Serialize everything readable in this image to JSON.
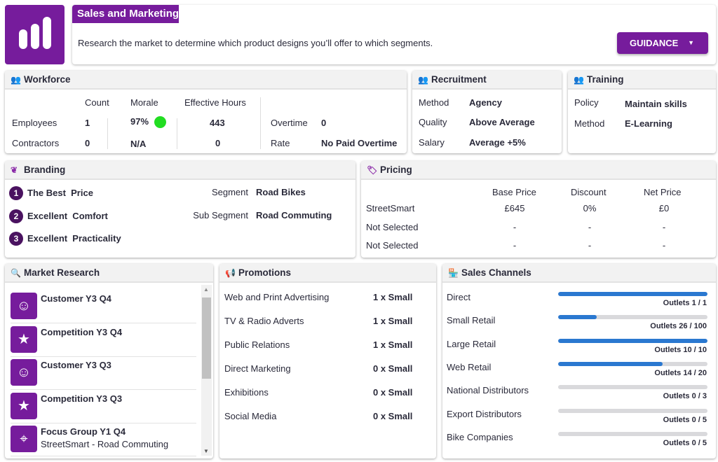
{
  "header": {
    "title": "Sales and Marketing",
    "description": "Research the market to determine which product designs you’ll offer to which segments.",
    "guidance_label": "GUIDANCE"
  },
  "workforce": {
    "title": "Workforce",
    "cols": [
      "Count",
      "Morale",
      "Effective Hours"
    ],
    "rows": [
      {
        "label": "Employees",
        "count": "1",
        "morale": "97%",
        "hours": "443"
      },
      {
        "label": "Contractors",
        "count": "0",
        "morale": "N/A",
        "hours": "0"
      }
    ],
    "overtime_label": "Overtime",
    "overtime": "0",
    "rate_label": "Rate",
    "rate": "No Paid Overtime",
    "morale_icon": "smiley-green"
  },
  "recruitment": {
    "title": "Recruitment",
    "rows": [
      {
        "k": "Method",
        "v": "Agency"
      },
      {
        "k": "Quality",
        "v": "Above Average"
      },
      {
        "k": "Salary",
        "v": "Average +5%"
      }
    ]
  },
  "training": {
    "title": "Training",
    "rows": [
      {
        "k": "Policy",
        "v": "Maintain skills"
      },
      {
        "k": "Method",
        "v": "E-Learning"
      }
    ]
  },
  "branding": {
    "title": "Branding",
    "items": [
      {
        "n": "1",
        "text": "The Best  Price"
      },
      {
        "n": "2",
        "text": "Excellent  Comfort"
      },
      {
        "n": "3",
        "text": "Excellent  Practicality"
      }
    ],
    "segment_label": "Segment",
    "segment": "Road Bikes",
    "sub_segment_label": "Sub Segment",
    "sub_segment": "Road Commuting"
  },
  "pricing": {
    "title": "Pricing",
    "cols": [
      "Base Price",
      "Discount",
      "Net Price"
    ],
    "rows": [
      {
        "name": "StreetSmart",
        "base": "£645",
        "discount": "0%",
        "net": "£0"
      },
      {
        "name": "Not Selected",
        "base": "-",
        "discount": "-",
        "net": "-"
      },
      {
        "name": "Not Selected",
        "base": "-",
        "discount": "-",
        "net": "-"
      }
    ]
  },
  "market_research": {
    "title": "Market Research",
    "items": [
      {
        "title": "Customer Y3 Q4",
        "sub": "",
        "icon": "smiley"
      },
      {
        "title": "Competition Y3 Q4",
        "sub": "",
        "icon": "podium-stars"
      },
      {
        "title": "Customer Y3 Q3",
        "sub": "",
        "icon": "smiley"
      },
      {
        "title": "Competition Y3 Q3",
        "sub": "",
        "icon": "podium-stars"
      },
      {
        "title": "Focus Group Y1 Q4",
        "sub": "StreetSmart - Road Commuting",
        "icon": "target"
      }
    ]
  },
  "promotions": {
    "title": "Promotions",
    "items": [
      {
        "name": "Web and Print Advertising",
        "value": "1 x Small"
      },
      {
        "name": "TV & Radio Adverts",
        "value": "1 x Small"
      },
      {
        "name": "Public Relations",
        "value": "1 x Small"
      },
      {
        "name": "Direct Marketing",
        "value": "0 x Small"
      },
      {
        "name": "Exhibitions",
        "value": "0 x Small"
      },
      {
        "name": "Social Media",
        "value": "0 x Small"
      }
    ]
  },
  "sales_channels": {
    "title": "Sales Channels",
    "items": [
      {
        "name": "Direct",
        "outlets": "Outlets 1 / 1",
        "fill": 1.0
      },
      {
        "name": "Small Retail",
        "outlets": "Outlets 26 / 100",
        "fill": 0.26
      },
      {
        "name": "Large Retail",
        "outlets": "Outlets 10 / 10",
        "fill": 1.0
      },
      {
        "name": "Web Retail",
        "outlets": "Outlets 14 / 20",
        "fill": 0.7
      },
      {
        "name": "National Distributors",
        "outlets": "Outlets 0 / 3",
        "fill": 0
      },
      {
        "name": "Export Distributors",
        "outlets": "Outlets 0 / 5",
        "fill": 0
      },
      {
        "name": "Bike Companies",
        "outlets": "Outlets 0 / 5",
        "fill": 0
      }
    ]
  },
  "colors": {
    "brand": "#761c9c",
    "bar": "#2a78d0"
  }
}
